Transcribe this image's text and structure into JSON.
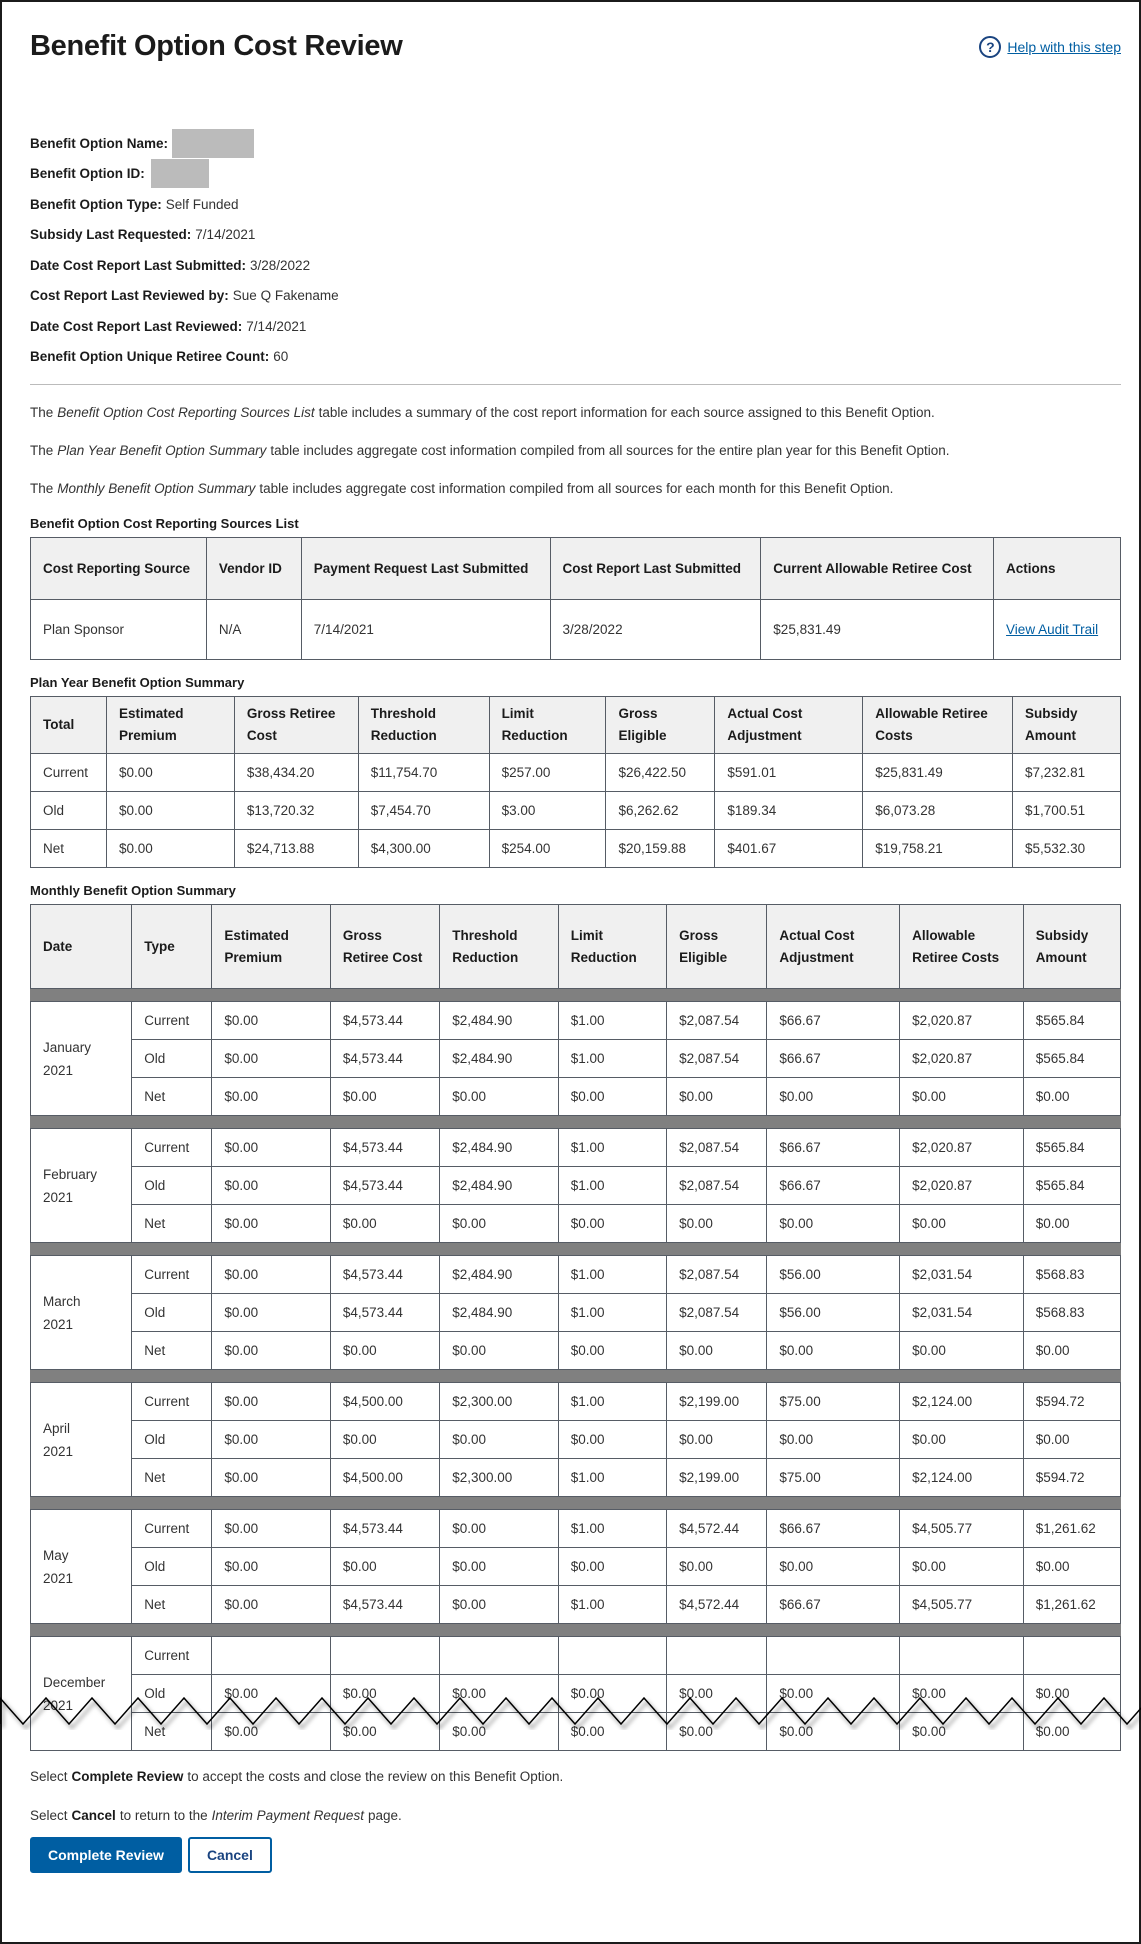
{
  "header": {
    "title": "Benefit Option Cost Review",
    "help_label": "Help with this step",
    "help_icon": "question-circle-icon"
  },
  "meta": [
    {
      "label": "Benefit Option Name:",
      "value": "",
      "redacted": true
    },
    {
      "label": "Benefit Option ID:",
      "value": "",
      "redacted": true
    },
    {
      "label": "Benefit Option Type:",
      "value": "Self Funded"
    },
    {
      "label": "Subsidy Last Requested:",
      "value": "7/14/2021"
    },
    {
      "label": "Date Cost Report Last Submitted:",
      "value": "3/28/2022"
    },
    {
      "label": "Cost Report Last Reviewed by:",
      "value": "Sue Q Fakename"
    },
    {
      "label": "Date Cost Report Last Reviewed:",
      "value": "7/14/2021"
    },
    {
      "label": "Benefit Option Unique Retiree Count:",
      "value": "60"
    }
  ],
  "intro": [
    {
      "pre": "The",
      "em": "Benefit Option Cost Reporting Sources List",
      "post": "table includes a summary of the cost report information for each source assigned to this Benefit Option."
    },
    {
      "pre": "The",
      "em": "Plan Year Benefit Option Summary",
      "post": "table includes aggregate cost information compiled from all sources for the entire plan year for this Benefit Option."
    },
    {
      "pre": "The",
      "em": "Monthly Benefit Option Summary",
      "post": "table includes aggregate cost information compiled from all sources for each month for this Benefit Option."
    }
  ],
  "sources": {
    "title": "Benefit Option Cost Reporting Sources List",
    "headers": [
      "Cost Reporting Source",
      "Vendor ID",
      "Payment Request Last Submitted",
      "Cost Report Last Submitted",
      "Current Allowable Retiree Cost",
      "Actions"
    ],
    "rows": [
      {
        "source": "Plan Sponsor",
        "vendor_id": "N/A",
        "payment_last": "7/14/2021",
        "report_last": "3/28/2022",
        "allowable": "$25,831.49",
        "action": "View Audit Trail"
      }
    ]
  },
  "plan_year": {
    "title": "Plan Year Benefit Option Summary",
    "headers": [
      "Total",
      "Estimated Premium",
      "Gross Retiree Cost",
      "Threshold Reduction",
      "Limit Reduction",
      "Gross Eligible",
      "Actual Cost Adjustment",
      "Allowable Retiree Costs",
      "Subsidy Amount"
    ],
    "rows": [
      [
        "Current",
        "$0.00",
        "$38,434.20",
        "$11,754.70",
        "$257.00",
        "$26,422.50",
        "$591.01",
        "$25,831.49",
        "$7,232.81"
      ],
      [
        "Old",
        "$0.00",
        "$13,720.32",
        "$7,454.70",
        "$3.00",
        "$6,262.62",
        "$189.34",
        "$6,073.28",
        "$1,700.51"
      ],
      [
        "Net",
        "$0.00",
        "$24,713.88",
        "$4,300.00",
        "$254.00",
        "$20,159.88",
        "$401.67",
        "$19,758.21",
        "$5,532.30"
      ]
    ]
  },
  "monthly": {
    "title": "Monthly Benefit Option Summary",
    "headers": [
      "Date",
      "Type",
      "Estimated Premium",
      "Gross Retiree Cost",
      "Threshold Reduction",
      "Limit Reduction",
      "Gross Eligible",
      "Actual Cost Adjustment",
      "Allowable Retiree Costs",
      "Subsidy Amount"
    ],
    "months": [
      {
        "month": "January",
        "year": "2021",
        "rows": [
          [
            "Current",
            "$0.00",
            "$4,573.44",
            "$2,484.90",
            "$1.00",
            "$2,087.54",
            "$66.67",
            "$2,020.87",
            "$565.84"
          ],
          [
            "Old",
            "$0.00",
            "$4,573.44",
            "$2,484.90",
            "$1.00",
            "$2,087.54",
            "$66.67",
            "$2,020.87",
            "$565.84"
          ],
          [
            "Net",
            "$0.00",
            "$0.00",
            "$0.00",
            "$0.00",
            "$0.00",
            "$0.00",
            "$0.00",
            "$0.00"
          ]
        ]
      },
      {
        "month": "February",
        "year": "2021",
        "rows": [
          [
            "Current",
            "$0.00",
            "$4,573.44",
            "$2,484.90",
            "$1.00",
            "$2,087.54",
            "$66.67",
            "$2,020.87",
            "$565.84"
          ],
          [
            "Old",
            "$0.00",
            "$4,573.44",
            "$2,484.90",
            "$1.00",
            "$2,087.54",
            "$66.67",
            "$2,020.87",
            "$565.84"
          ],
          [
            "Net",
            "$0.00",
            "$0.00",
            "$0.00",
            "$0.00",
            "$0.00",
            "$0.00",
            "$0.00",
            "$0.00"
          ]
        ]
      },
      {
        "month": "March",
        "year": "2021",
        "rows": [
          [
            "Current",
            "$0.00",
            "$4,573.44",
            "$2,484.90",
            "$1.00",
            "$2,087.54",
            "$56.00",
            "$2,031.54",
            "$568.83"
          ],
          [
            "Old",
            "$0.00",
            "$4,573.44",
            "$2,484.90",
            "$1.00",
            "$2,087.54",
            "$56.00",
            "$2,031.54",
            "$568.83"
          ],
          [
            "Net",
            "$0.00",
            "$0.00",
            "$0.00",
            "$0.00",
            "$0.00",
            "$0.00",
            "$0.00",
            "$0.00"
          ]
        ]
      },
      {
        "month": "April",
        "year": "2021",
        "rows": [
          [
            "Current",
            "$0.00",
            "$4,500.00",
            "$2,300.00",
            "$1.00",
            "$2,199.00",
            "$75.00",
            "$2,124.00",
            "$594.72"
          ],
          [
            "Old",
            "$0.00",
            "$0.00",
            "$0.00",
            "$0.00",
            "$0.00",
            "$0.00",
            "$0.00",
            "$0.00"
          ],
          [
            "Net",
            "$0.00",
            "$4,500.00",
            "$2,300.00",
            "$1.00",
            "$2,199.00",
            "$75.00",
            "$2,124.00",
            "$594.72"
          ]
        ]
      },
      {
        "month": "May",
        "year": "2021",
        "rows": [
          [
            "Current",
            "$0.00",
            "$4,573.44",
            "$0.00",
            "$1.00",
            "$4,572.44",
            "$66.67",
            "$4,505.77",
            "$1,261.62"
          ],
          [
            "Old",
            "$0.00",
            "$0.00",
            "$0.00",
            "$0.00",
            "$0.00",
            "$0.00",
            "$0.00",
            "$0.00"
          ],
          [
            "Net",
            "$0.00",
            "$4,573.44",
            "$0.00",
            "$1.00",
            "$4,572.44",
            "$66.67",
            "$4,505.77",
            "$1,261.62"
          ]
        ]
      },
      {
        "month": "December",
        "year": "2021",
        "rows": [
          [
            "Current",
            "",
            "",
            "",
            "",
            "",
            "",
            "",
            ""
          ],
          [
            "Old",
            "$0.00",
            "$0.00",
            "$0.00",
            "$0.00",
            "$0.00",
            "$0.00",
            "$0.00",
            "$0.00"
          ],
          [
            "Net",
            "$0.00",
            "$0.00",
            "$0.00",
            "$0.00",
            "$0.00",
            "$0.00",
            "$0.00",
            "$0.00"
          ]
        ]
      }
    ]
  },
  "footer": {
    "line1": {
      "pre": "Select",
      "bold": "Complete Review",
      "post": "to accept the costs and close the review on this Benefit Option."
    },
    "line2": {
      "pre": "Select",
      "bold": "Cancel",
      "post_a": "to return to the",
      "em": "Interim Payment Request",
      "post_b": "page."
    },
    "complete_label": "Complete Review",
    "cancel_label": "Cancel"
  },
  "colors": {
    "primary": "#005ea2",
    "link": "#005ea2",
    "header_bg": "#f0f0f0",
    "month_separator": "#808080",
    "redaction": "#bbbbbb"
  }
}
